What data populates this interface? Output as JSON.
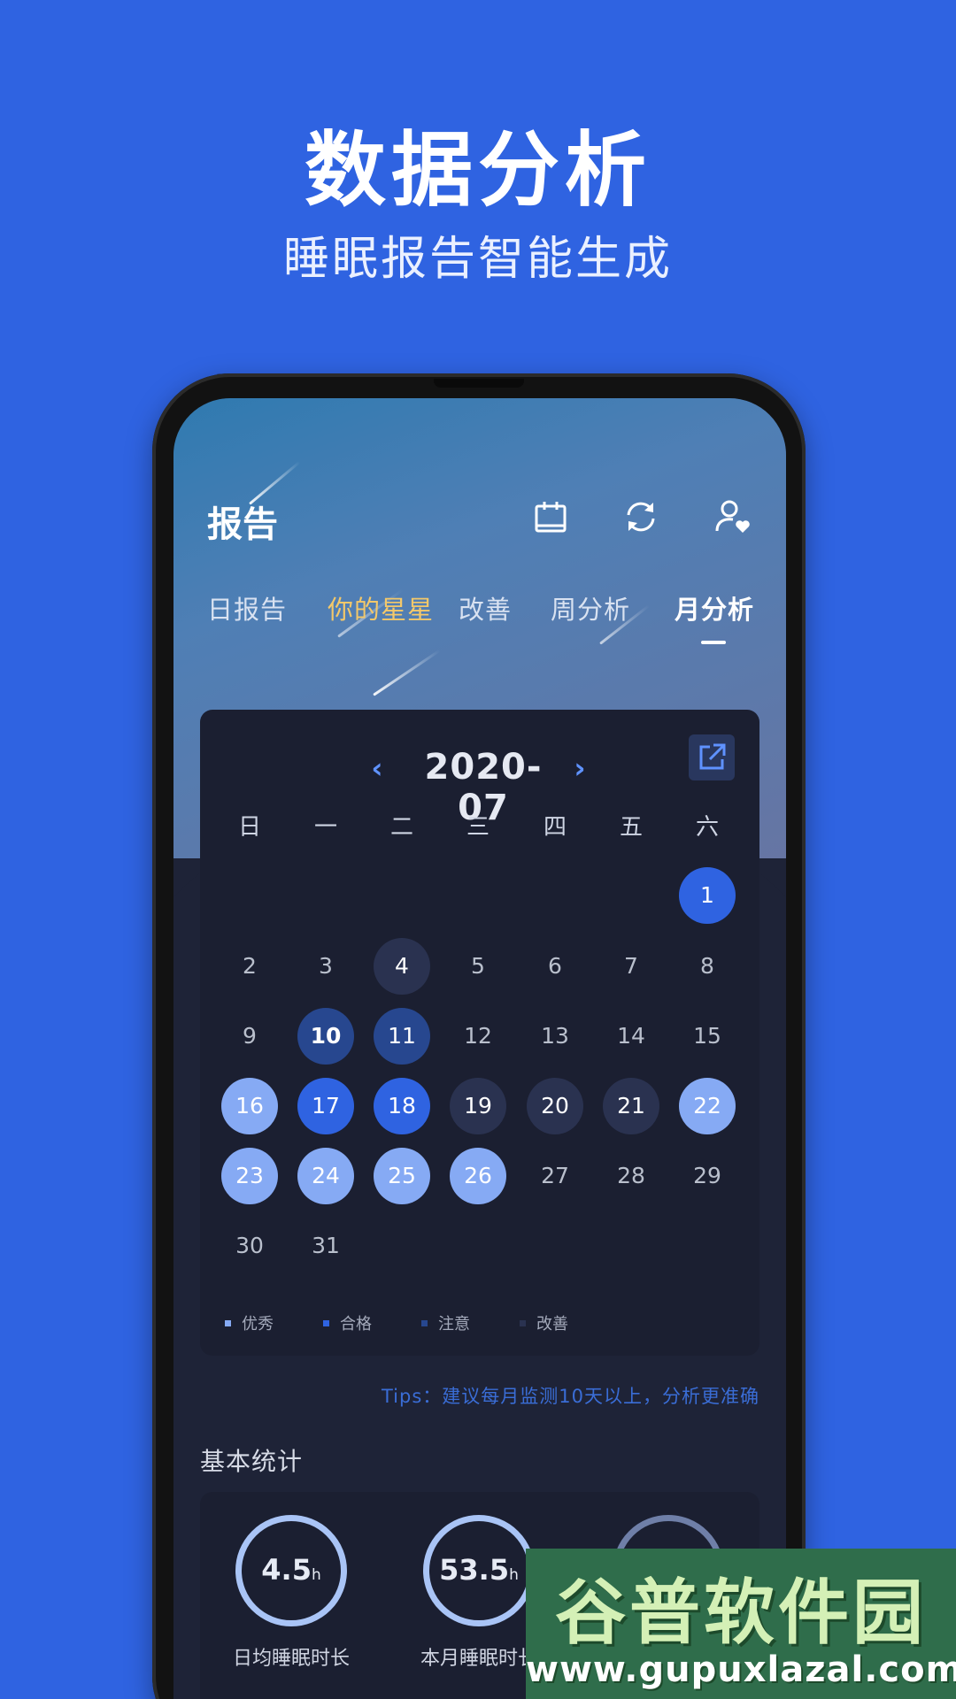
{
  "promo": {
    "title": "数据分析",
    "subtitle": "睡眠报告智能生成"
  },
  "header": {
    "title": "报告",
    "icons": [
      "calendar-icon",
      "refresh-icon",
      "user-heart-icon"
    ]
  },
  "tabs": [
    {
      "label": "日报告"
    },
    {
      "label": "你的星星"
    },
    {
      "label": "改善"
    },
    {
      "label": "周分析"
    },
    {
      "label": "月分析"
    }
  ],
  "calendar": {
    "month": "2020-07",
    "prev": "‹",
    "next": "›",
    "weekdays": [
      "日",
      "一",
      "二",
      "三",
      "四",
      "五",
      "六"
    ],
    "days": [
      "1",
      "2",
      "3",
      "4",
      "5",
      "6",
      "7",
      "8",
      "9",
      "10",
      "11",
      "12",
      "13",
      "14",
      "15",
      "16",
      "17",
      "18",
      "19",
      "20",
      "21",
      "22",
      "23",
      "24",
      "25",
      "26",
      "27",
      "28",
      "29",
      "30",
      "31"
    ],
    "legend": [
      {
        "label": "优秀",
        "color": "#86aaf4"
      },
      {
        "label": "合格",
        "color": "#2f63e1"
      },
      {
        "label": "注意",
        "color": "#27478f"
      },
      {
        "label": "改善",
        "color": "#2a3250"
      }
    ]
  },
  "tips": "Tips：建议每月监测10天以上，分析更准确",
  "stats": {
    "title": "基本统计",
    "items": [
      {
        "value": "4.5",
        "unit": "h",
        "label": "日均睡眠时长"
      },
      {
        "value": "53.5",
        "unit": "h",
        "label": "本月睡眠时长"
      }
    ]
  },
  "watermark": {
    "name": "谷普软件园",
    "url": "www.gupuxlazal.com"
  },
  "colors": {
    "background": "#2f63e1",
    "accent": "#5f92ff",
    "highlight_tab": "#f3c86a"
  }
}
